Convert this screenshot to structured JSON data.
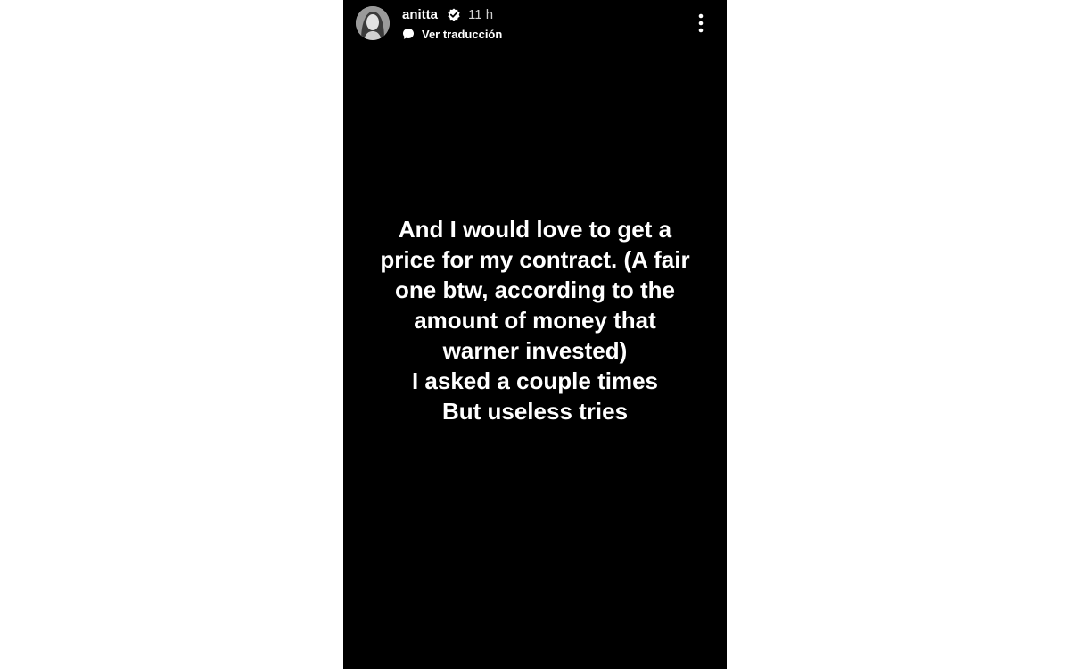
{
  "story": {
    "username": "anitta",
    "timestamp": "11 h",
    "translate_label": "Ver traducción",
    "lines": [
      "And I would love to get a",
      "price for my contract. (A fair",
      "one btw, according to the",
      "amount of money that",
      "warner invested)",
      "I asked a couple times",
      "But useless tries"
    ]
  },
  "icons": {
    "avatar": "profile-photo",
    "verified": "verified-badge-icon",
    "translate": "translate-icon",
    "more": "more-options-icon"
  },
  "colors": {
    "story_background": "#000000",
    "page_background": "#ffffff",
    "text": "#ffffff"
  }
}
